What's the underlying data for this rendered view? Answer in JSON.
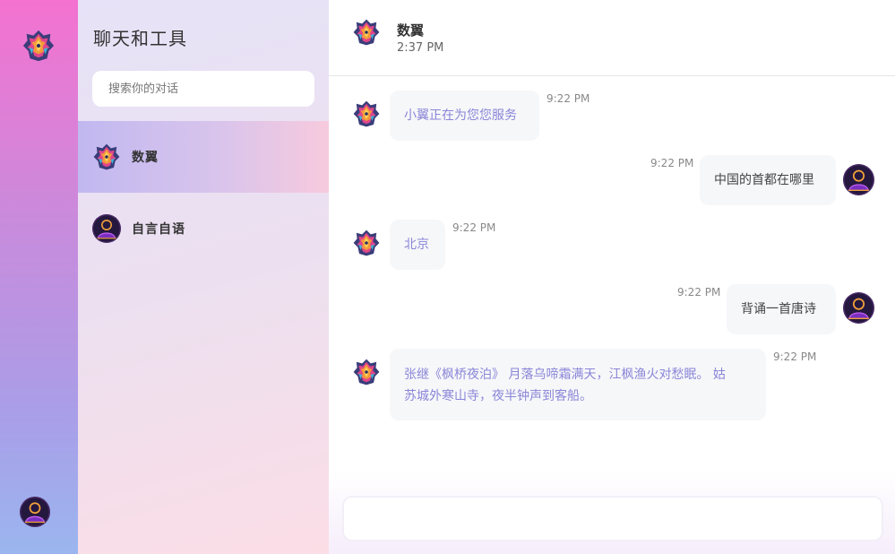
{
  "sidebar_title": "聊天和工具",
  "search": {
    "placeholder": "搜索你的对话"
  },
  "conversations": [
    {
      "name": "数翼",
      "active": true
    },
    {
      "name": "自言自语",
      "active": false
    }
  ],
  "header": {
    "title": "数翼",
    "time": "2:37 PM"
  },
  "messages": [
    {
      "role": "bot",
      "text": "小翼正在为您您服务",
      "time": "9:22 PM"
    },
    {
      "role": "user",
      "text": "中国的首都在哪里",
      "time": "9:22 PM"
    },
    {
      "role": "bot",
      "text": "北京",
      "time": "9:22 PM"
    },
    {
      "role": "user",
      "text": "背诵一首唐诗",
      "time": "9:22 PM"
    },
    {
      "role": "bot",
      "lines": [
        "张继《枫桥夜泊》 月落乌啼霜满天，江枫渔火对愁眠。 姑",
        "苏城外寒山寺，夜半钟声到客船。"
      ],
      "time": "9:22 PM"
    }
  ],
  "composer": {
    "value": ""
  },
  "colors": {
    "bot_text": "#8a86d8",
    "rail_top": "#f472d0",
    "rail_bottom": "#9bb6ef"
  }
}
